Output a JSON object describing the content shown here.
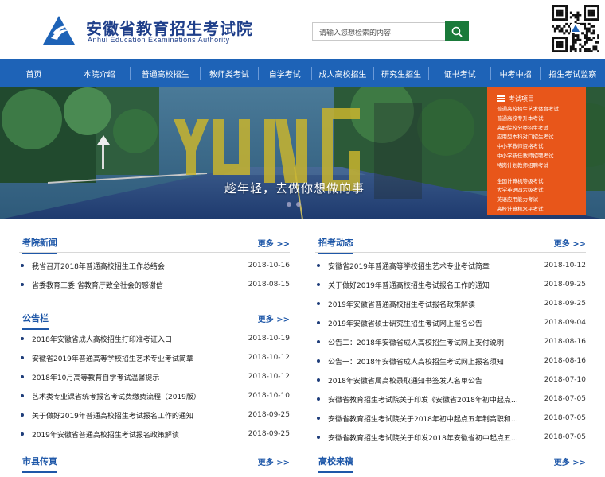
{
  "header": {
    "logo_cn": "安徽省教育招生考试院",
    "logo_en": "Anhui Education Examinations Authority",
    "search_placeholder": "请输入您想检索的内容",
    "brand_color": "#1e63b7"
  },
  "nav": {
    "items": [
      {
        "label": "首页"
      },
      {
        "label": "本院介绍"
      },
      {
        "label": "普通高校招生"
      },
      {
        "label": "教师类考试"
      },
      {
        "label": "自学考试"
      },
      {
        "label": "成人高校招生"
      },
      {
        "label": "研究生招生"
      },
      {
        "label": "证书考试"
      },
      {
        "label": "中考中招"
      },
      {
        "label": "招生考试监察"
      }
    ]
  },
  "banner": {
    "slogan": "趁年轻，去做你想做的事",
    "art_text": "YOUNG",
    "exam_panel": {
      "title": "考试项目",
      "group1": [
        "普通高校招生艺术体育考试",
        "普通高校专升本考试",
        "高职院校分类招生考试",
        "应用型本科对口招生考试",
        "中小学教师资格考试",
        "中小学新任教师招聘考试",
        "特岗计划教师招聘考试"
      ],
      "group2": [
        "全国计算机等级考试",
        "大学英语四六级考试",
        "英语应用能力考试",
        "高校计算机水平考试"
      ]
    }
  },
  "sections": {
    "kaoyuan": {
      "title": "考院新闻",
      "more": "更多 >>",
      "items": [
        {
          "title": "我省召开2018年普通高校招生工作总结会",
          "date": "2018-10-16"
        },
        {
          "title": "省委教育工委 省教育厅致全社会的感谢信",
          "date": "2018-08-15"
        }
      ]
    },
    "gonggao": {
      "title": "公告栏",
      "more": "更多 >>",
      "items": [
        {
          "title": "2018年安徽省成人高校招生打印准考证入口",
          "date": "2018-10-19"
        },
        {
          "title": "安徽省2019年普通高等学校招生艺术专业考试简章",
          "date": "2018-10-12"
        },
        {
          "title": "2018年10月高等教育自学考试温馨提示",
          "date": "2018-10-12"
        },
        {
          "title": "艺术类专业课省统考报名考试费缴费流程（2019版）",
          "date": "2018-10-10"
        },
        {
          "title": "关于做好2019年普通高校招生考试报名工作的通知",
          "date": "2018-09-25"
        },
        {
          "title": "2019年安徽省普通高校招生考试报名政策解读",
          "date": "2018-09-25"
        }
      ]
    },
    "shixian": {
      "title": "市县传真",
      "more": "更多 >>"
    },
    "zhaokao": {
      "title": "招考动态",
      "more": "更多 >>",
      "items": [
        {
          "title": "安徽省2019年普通高等学校招生艺术专业考试简章",
          "date": "2018-10-12"
        },
        {
          "title": "关于做好2019年普通高校招生考试报名工作的通知",
          "date": "2018-09-25"
        },
        {
          "title": "2019年安徽省普通高校招生考试报名政策解读",
          "date": "2018-09-25"
        },
        {
          "title": "2019年安徽省硕士研究生招生考试网上报名公告",
          "date": "2018-09-04"
        },
        {
          "title": "公告二：2018年安徽省成人高校招生考试网上支付说明",
          "date": "2018-08-16"
        },
        {
          "title": "公告一：2018年安徽省成人高校招生考试网上报名须知",
          "date": "2018-08-16"
        },
        {
          "title": "2018年安徽省属高校录取通知书签发人名单公告",
          "date": "2018-07-10"
        },
        {
          "title": "安徽省教育招生考试院关于印发《安徽省2018年初中起点…",
          "date": "2018-07-05"
        },
        {
          "title": "安徽省教育招生考试院关于2018年初中起点五年制高职和…",
          "date": "2018-07-05"
        },
        {
          "title": "安徽省教育招生考试院关于印发2018年安徽省初中起点五…",
          "date": "2018-07-05"
        }
      ]
    },
    "gaoxiao": {
      "title": "高校来稿",
      "more": "更多 >>"
    }
  }
}
